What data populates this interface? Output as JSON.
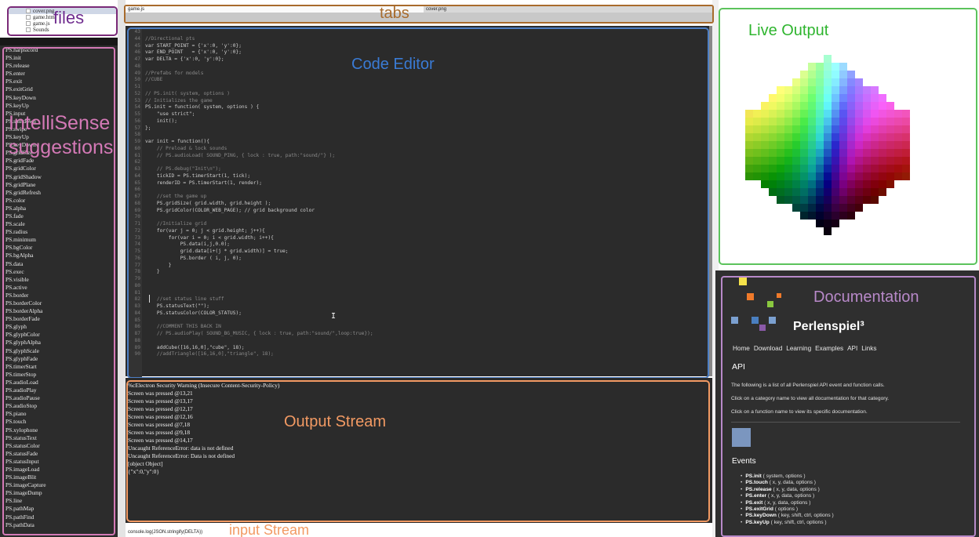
{
  "labels": {
    "files": "files",
    "tabs": "tabs",
    "code_editor": "Code Editor",
    "intellisense": "IntelliSense suggestions",
    "output_stream": "Output Stream",
    "input_stream": "input Stream",
    "live_output": "Live Output",
    "documentation": "Documentation"
  },
  "files": [
    {
      "name": "cover.png",
      "selected": true
    },
    {
      "name": "game.html",
      "selected": false
    },
    {
      "name": "game.js",
      "selected": false
    },
    {
      "name": "Sounds",
      "selected": false
    }
  ],
  "tabs": [
    {
      "label": "game.js"
    },
    {
      "label": "cover.png"
    }
  ],
  "suggestions": [
    "PS.harpsicord",
    "PS.init",
    "PS.release",
    "PS.enter",
    "PS.exit",
    "PS.exitGrid",
    "PS.keyDown",
    "PS.keyUp",
    "PS.input",
    "PS.shutdown",
    "PS.swipe",
    "PS.keyUp",
    "PS.keyDown",
    "PS.gridSize",
    "PS.gridFade",
    "PS.gridColor",
    "PS.gridShadow",
    "PS.gridPlane",
    "PS.gridRefresh",
    "PS.color",
    "PS.alpha",
    "PS.fade",
    "PS.scale",
    "PS.radius",
    "PS.minimum",
    "PS.bgColor",
    "PS.bgAlpha",
    "PS.data",
    "PS.exec",
    "PS.visible",
    "PS.active",
    "PS.border",
    "PS.borderColor",
    "PS.borderAlpha",
    "PS.borderFade",
    "PS.glyph",
    "PS.glyphColor",
    "PS.glyphAlpha",
    "PS.glyphScale",
    "PS.glyphFade",
    "PS.timerStart",
    "PS.timerStop",
    "PS.audioLoad",
    "PS.audioPlay",
    "PS.audioPause",
    "PS.audioStop",
    "PS.piano",
    "PS.touch",
    "PS.xylophone",
    "PS.statusText",
    "PS.statusColor",
    "PS.statusFade",
    "PS.statusInput",
    "PS.imageLoad",
    "PS.imageBlit",
    "PS.imageCapture",
    "PS.imageDump",
    "PS.line",
    "PS.pathMap",
    "PS.pathFind",
    "PS.pathData"
  ],
  "code_lines": [
    {
      "n": "43",
      "t": ""
    },
    {
      "n": "44",
      "t": "//Directional pts",
      "c": true
    },
    {
      "n": "45",
      "t": "var START_POINT = {'x':0, 'y':0};"
    },
    {
      "n": "46",
      "t": "var END_POINT   = {'x':0, 'y':0};"
    },
    {
      "n": "47",
      "t": "var DELTA = {'x':0, 'y':0};"
    },
    {
      "n": "48",
      "t": ""
    },
    {
      "n": "49",
      "t": "//Prefabs for models",
      "c": true
    },
    {
      "n": "50",
      "t": "//CUBE",
      "c": true
    },
    {
      "n": "51",
      "t": ""
    },
    {
      "n": "52",
      "t": "// PS.init( system, options )",
      "c": true
    },
    {
      "n": "53",
      "t": "// Initializes the game",
      "c": true
    },
    {
      "n": "54",
      "t": "PS.init = function( system, options ) {"
    },
    {
      "n": "55",
      "t": "    \"use strict\";"
    },
    {
      "n": "56",
      "t": "    init();"
    },
    {
      "n": "57",
      "t": "};"
    },
    {
      "n": "58",
      "t": ""
    },
    {
      "n": "59",
      "t": "var init = function(){"
    },
    {
      "n": "60",
      "t": "    // Preload & lock sounds",
      "c": true
    },
    {
      "n": "61",
      "t": "    // PS.audioLoad( SOUND_PING, { lock : true, path:\"sound/\"} );",
      "c": true
    },
    {
      "n": "62",
      "t": ""
    },
    {
      "n": "63",
      "t": "    // PS.debug(\"Init\\n\");",
      "c": true
    },
    {
      "n": "64",
      "t": "    tickID = PS.timerStart(1, tick);"
    },
    {
      "n": "65",
      "t": "    renderID = PS.timerStart(1, render);"
    },
    {
      "n": "66",
      "t": ""
    },
    {
      "n": "67",
      "t": "    //set the game up",
      "c": true
    },
    {
      "n": "68",
      "t": "    PS.gridSize( grid.width, grid.height );"
    },
    {
      "n": "69",
      "t": "    PS.gridColor(COLOR_WEB_PAGE); // grid background color"
    },
    {
      "n": "70",
      "t": ""
    },
    {
      "n": "71",
      "t": "    //Initialize grid",
      "c": true
    },
    {
      "n": "72",
      "t": "    for(var j = 0; j < grid.height; j++){"
    },
    {
      "n": "73",
      "t": "        for(var i = 0; i < grid.width; i++){"
    },
    {
      "n": "74",
      "t": "            PS.data(i,j,0.0);"
    },
    {
      "n": "75",
      "t": "            grid.data[i+(j * grid.width)] = true;"
    },
    {
      "n": "76",
      "t": "            PS.border ( i, j, 0);"
    },
    {
      "n": "77",
      "t": "        }"
    },
    {
      "n": "78",
      "t": "    }"
    },
    {
      "n": "79",
      "t": ""
    },
    {
      "n": "80",
      "t": ""
    },
    {
      "n": "81",
      "t": ""
    },
    {
      "n": "82",
      "t": "    //set status line stuff",
      "c": true
    },
    {
      "n": "83",
      "t": "    PS.statusText(\"\");"
    },
    {
      "n": "84",
      "t": "    PS.statusColor(COLOR_STATUS);"
    },
    {
      "n": "85",
      "t": ""
    },
    {
      "n": "86",
      "t": "    //COMMENT THIS BACK IN",
      "c": true
    },
    {
      "n": "87",
      "t": "    // PS.audioPlay( SOUND_BG_MUSIC, { lock : true, path:\"sound/\",loop:true});",
      "c": true
    },
    {
      "n": "88",
      "t": ""
    },
    {
      "n": "89",
      "t": "    addCube([16,16,0],\"cube\", 18);"
    },
    {
      "n": "90",
      "t": "    //addTriangle([16,16,0],\"triangle\", 18);",
      "c": true
    }
  ],
  "output_lines": [
    "%cElectron Security Warning (Insecure Content-Security-Policy)",
    "Screen was pressed @13,21",
    "Screen was pressed @13,17",
    "Screen was pressed @12,17",
    "Screen was pressed @12,16",
    "Screen was pressed @7,18",
    "Screen was pressed @9,18",
    "Screen was pressed @14,17",
    "Uncaught ReferenceError: data is not defined",
    "Uncaught ReferenceError: Data is not defined",
    "[object Object]",
    "{\"x\":0,\"y\":0}"
  ],
  "input": {
    "value": "console.log(JSON.stringify(DELTA))"
  },
  "docs": {
    "brand": "Perlenspiel³",
    "nav": [
      "Home",
      "Download",
      "Learning",
      "Examples",
      "API",
      "Links"
    ],
    "heading": "API",
    "paragraphs": [
      "The following is a list of all Perlenspiel API event and function calls.",
      "Click on a category name to view all documentation for that category.",
      "Click on a function name to view its specific documentation."
    ],
    "events_heading": "Events",
    "events": [
      {
        "name": "PS.init",
        "args": "( system, options )"
      },
      {
        "name": "PS.touch",
        "args": "( x, y, data, options )"
      },
      {
        "name": "PS.release",
        "args": "( x, y, data, options )"
      },
      {
        "name": "PS.enter",
        "args": "( x, y, data, options )"
      },
      {
        "name": "PS.exit",
        "args": "( x, y, data, options )"
      },
      {
        "name": "PS.exitGrid",
        "args": "( options )"
      },
      {
        "name": "PS.keyDown",
        "args": "( key, shift, ctrl, options )"
      },
      {
        "name": "PS.keyUp",
        "args": "( key, shift, ctrl, options )"
      }
    ],
    "logo_colors": [
      "#f5e24a",
      "#f07a2a",
      "#8ac83f",
      "#f07a2a",
      "#7ba0d0",
      "#4a7fc0",
      "#7ba0d0",
      "#8a5aa8"
    ]
  },
  "colors": {
    "files_annotation": "#6f2c8e",
    "tabs_annotation": "#a86b2c",
    "editor_annotation": "#3a7bd5",
    "intellisense_annotation": "#d479b6",
    "output_annotation": "#f29a63",
    "live_output_annotation": "#2fb52f",
    "docs_annotation": "#b889c9"
  }
}
